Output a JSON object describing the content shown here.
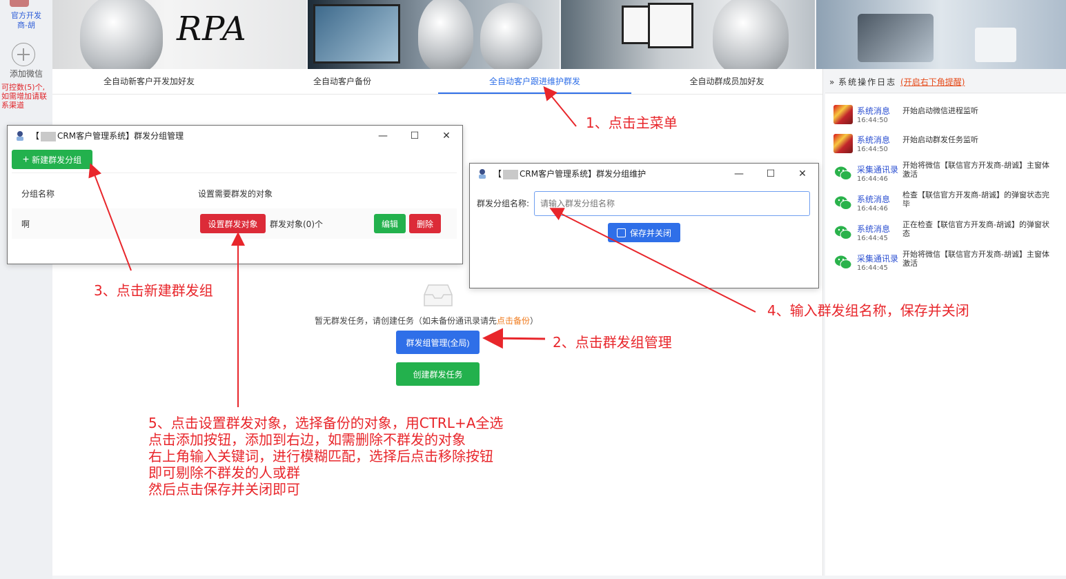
{
  "sidebar": {
    "account_name_line1": "官方开发",
    "account_name_line2": "商-胡",
    "add_wechat_label": "添加微信",
    "limit_note": "可控数(5)个,如需增加请联系渠道"
  },
  "banner": {
    "logo_text": "RPA"
  },
  "tabs": [
    {
      "label": "全自动新客户开发加好友"
    },
    {
      "label": "全自动客户备份"
    },
    {
      "label": "全自动客户跟进维护群发"
    },
    {
      "label": "全自动群成员加好友"
    }
  ],
  "empty_state": {
    "text": "暂无群发任务，请创建任务（如未备份通讯录请先",
    "link": "点击备份",
    "text_end": "）",
    "manage_button": "群发组管理(全局)",
    "create_button": "创建群发任务"
  },
  "group_window": {
    "title_prefix": "【",
    "title_suffix": "CRM客户管理系统】群发分组管理",
    "new_group_button": "新建群发分组",
    "col_name": "分组名称",
    "col_target": "设置需要群发的对象",
    "row": {
      "name": "啊",
      "set_target_button": "设置群发对象",
      "target_count": "群发对象(0)个",
      "edit_button": "编辑",
      "delete_button": "删除"
    }
  },
  "edit_window": {
    "title_prefix": "【",
    "title_suffix": "CRM客户管理系统】群发分组维护",
    "field_label": "群发分组名称:",
    "field_placeholder": "请输入群发分组名称",
    "save_button": "保存并关闭"
  },
  "log": {
    "header": "系统操作日志",
    "header_link": "(开启右下角提醒)",
    "items": [
      {
        "source": "系统消息",
        "time": "16:44:50",
        "message": "开始启动微信进程监听",
        "icon": "flag"
      },
      {
        "source": "系统消息",
        "time": "16:44:50",
        "message": "开始启动群发任务监听",
        "icon": "flag"
      },
      {
        "source": "采集通讯录",
        "time": "16:44:46",
        "message": "开始将微信【联信官方开发商-胡诚】主窗体激活",
        "icon": "wechat"
      },
      {
        "source": "系统消息",
        "time": "16:44:46",
        "message": "检查【联信官方开发商-胡诚】的弹窗状态完毕",
        "icon": "wechat"
      },
      {
        "source": "系统消息",
        "time": "16:44:45",
        "message": "正在检查【联信官方开发商-胡诚】的弹窗状态",
        "icon": "wechat"
      },
      {
        "source": "采集通讯录",
        "time": "16:44:45",
        "message": "开始将微信【联信官方开发商-胡诚】主窗体激活",
        "icon": "wechat"
      }
    ]
  },
  "annotations": {
    "step1": "1、点击主菜单",
    "step2": "2、点击群发组管理",
    "step3": "3、点击新建群发组",
    "step4": "4、输入群发组名称，保存并关闭",
    "step5": [
      "5、点击设置群发对象，选择备份的对象，用CTRL+A全选",
      "点击添加按钮，添加到右边，如需删除不群发的对象",
      "右上角输入关键词，进行模糊匹配，选择后点击移除按钮",
      "即可剔除不群发的人或群",
      "然后点击保存并关闭即可"
    ]
  },
  "colors": {
    "accent_blue": "#2f6fe8",
    "success_green": "#23b14d",
    "danger_red": "#dc2b38",
    "annotation_red": "#e8262b"
  }
}
